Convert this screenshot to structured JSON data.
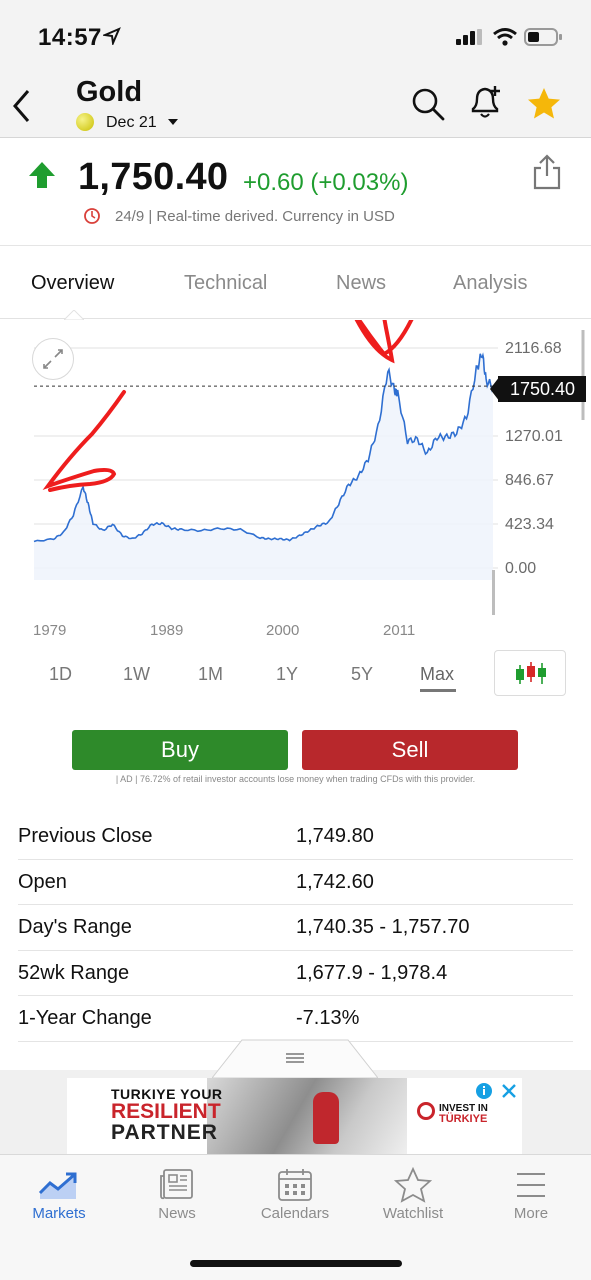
{
  "status_bar": {
    "time": "14:57"
  },
  "header": {
    "back_icon": "chevron-left-icon",
    "title": "Gold",
    "contract": "Dec 21",
    "icons": [
      "search-icon",
      "bell-plus-icon",
      "star-icon"
    ]
  },
  "quote": {
    "price": "1,750.40",
    "change": "+0.60 (+0.03%)",
    "meta": "24/9 | Real-time derived. Currency in USD",
    "direction": "up",
    "up_color": "#1f9d2f"
  },
  "tabs": [
    {
      "label": "Overview",
      "active": true
    },
    {
      "label": "Technical",
      "active": false
    },
    {
      "label": "News",
      "active": false
    },
    {
      "label": "Analysis",
      "active": false
    }
  ],
  "chart_data": {
    "type": "line",
    "x_ticks": [
      "1979",
      "1989",
      "2000",
      "2011"
    ],
    "y_ticks": [
      "2116.68",
      "1270.01",
      "846.67",
      "423.34",
      "0.00"
    ],
    "current_value": "1750.40",
    "ylim": [
      0,
      2116.68
    ],
    "grid": true,
    "series": [
      {
        "x": [
          1975,
          1977,
          1978,
          1979,
          1980,
          1980.5,
          1981,
          1982,
          1983,
          1984,
          1985,
          1986,
          1987,
          1988,
          1989,
          1990,
          1992,
          1994,
          1996,
          1998,
          1999,
          2000,
          2001,
          2002,
          2003,
          2004,
          2005,
          2006,
          2007,
          2008,
          2009,
          2010,
          2011,
          2011.7,
          2012,
          2013,
          2014,
          2015,
          2016,
          2017,
          2018,
          2019,
          2020,
          2020.6,
          2021,
          2021.7
        ],
        "y": [
          255,
          280,
          340,
          512,
          780,
          620,
          430,
          360,
          420,
          310,
          280,
          330,
          420,
          430,
          380,
          370,
          360,
          380,
          370,
          290,
          280,
          280,
          270,
          310,
          360,
          410,
          440,
          620,
          800,
          880,
          1050,
          1350,
          1900,
          1700,
          1680,
          1220,
          1240,
          1100,
          1260,
          1260,
          1300,
          1450,
          1900,
          2070,
          1800,
          1750
        ]
      }
    ],
    "line_color": "#2f6fd1"
  },
  "ranges": [
    {
      "label": "1D",
      "active": false
    },
    {
      "label": "1W",
      "active": false
    },
    {
      "label": "1M",
      "active": false
    },
    {
      "label": "1Y",
      "active": false
    },
    {
      "label": "5Y",
      "active": false
    },
    {
      "label": "Max",
      "active": true
    }
  ],
  "actions": {
    "buy": "Buy",
    "sell": "Sell",
    "disclaimer": "| AD | 76.72% of retail investor accounts lose money when trading CFDs with this provider."
  },
  "stats": [
    {
      "label": "Previous Close",
      "value": "1,749.80"
    },
    {
      "label": "Open",
      "value": "1,742.60"
    },
    {
      "label": "Day's Range",
      "value": "1,740.35 - 1,757.70"
    },
    {
      "label": "52wk Range",
      "value": "1,677.9 - 1,978.4"
    },
    {
      "label": "1-Year Change",
      "value": "-7.13%"
    }
  ],
  "ad": {
    "line1": "TURKIYE YOUR",
    "line2": "RESILIENT",
    "line3": "PARTNER",
    "brand_line1": "INVEST IN",
    "brand_line2": "TÜRKIYE"
  },
  "tabbar": [
    {
      "label": "Markets",
      "icon": "chart-up-icon",
      "active": true
    },
    {
      "label": "News",
      "icon": "newspaper-icon",
      "active": false
    },
    {
      "label": "Calendars",
      "icon": "calendar-icon",
      "active": false
    },
    {
      "label": "Watchlist",
      "icon": "star-outline-icon",
      "active": false
    },
    {
      "label": "More",
      "icon": "menu-icon",
      "active": false
    }
  ]
}
